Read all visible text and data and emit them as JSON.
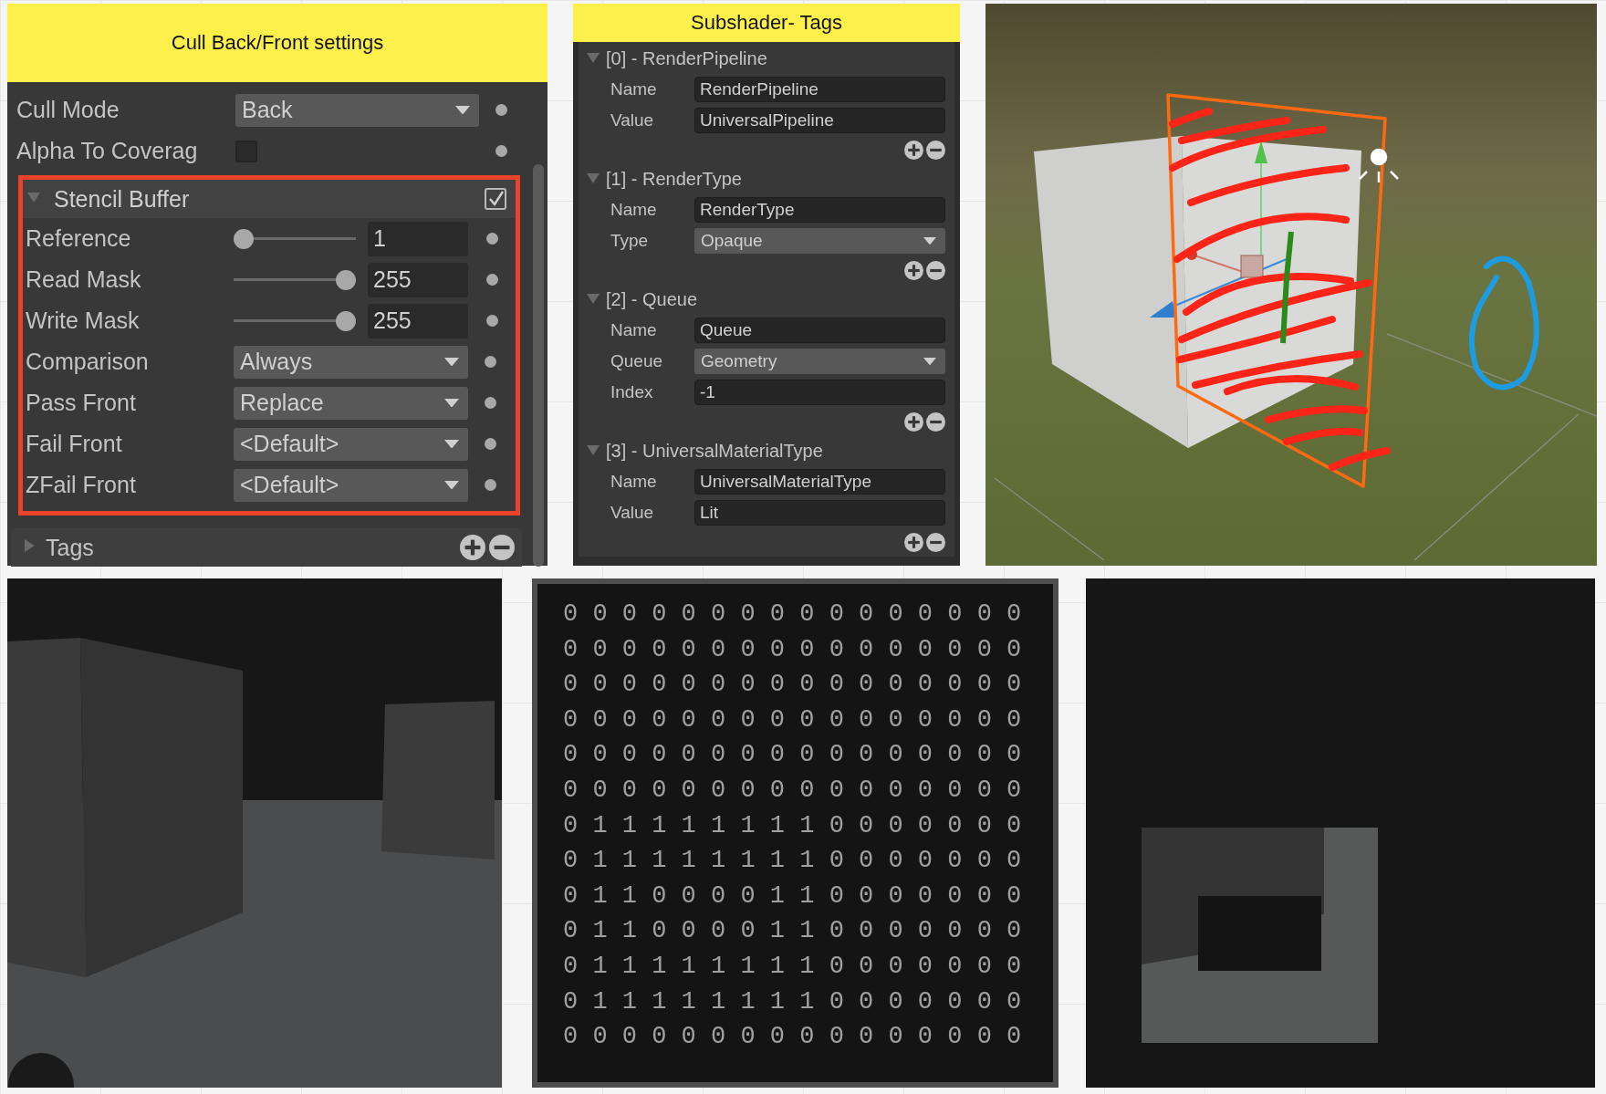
{
  "cull_panel": {
    "title": "Cull Back/Front settings",
    "properties": [
      {
        "kind": "dropdown",
        "label": "Cull Mode",
        "value": "Back"
      },
      {
        "kind": "checkbox",
        "label": "Alpha To Coverag",
        "checked": false
      }
    ],
    "stencil_buffer": {
      "title": "Stencil Buffer",
      "expanded": true,
      "checked": true,
      "properties": [
        {
          "kind": "slider",
          "label": "Reference",
          "value": "1",
          "level": 0
        },
        {
          "kind": "slider",
          "label": "Read Mask",
          "value": "255",
          "level": 1
        },
        {
          "kind": "slider",
          "label": "Write Mask",
          "value": "255",
          "level": 1
        },
        {
          "kind": "dropdown",
          "label": "Comparison",
          "value": "Always"
        },
        {
          "kind": "dropdown",
          "label": "Pass Front",
          "value": "Replace"
        },
        {
          "kind": "dropdown",
          "label": "Fail Front",
          "value": "<Default>"
        },
        {
          "kind": "dropdown",
          "label": "ZFail Front",
          "value": "<Default>"
        }
      ]
    },
    "tags": {
      "title": "Tags",
      "expanded": false
    }
  },
  "tags_panel": {
    "title": "Subshader- Tags",
    "tags": [
      {
        "header": "[0] - RenderPipeline",
        "expanded": true,
        "fields": [
          {
            "kind": "text",
            "label": "Name",
            "value": "RenderPipeline"
          },
          {
            "kind": "text",
            "label": "Value",
            "value": "UniversalPipeline"
          }
        ]
      },
      {
        "header": "[1] - RenderType",
        "expanded": true,
        "fields": [
          {
            "kind": "text",
            "label": "Name",
            "value": "RenderType"
          },
          {
            "kind": "dropdown",
            "label": "Type",
            "value": "Opaque"
          }
        ]
      },
      {
        "header": "[2] - Queue",
        "expanded": true,
        "fields": [
          {
            "kind": "text",
            "label": "Name",
            "value": "Queue"
          },
          {
            "kind": "dropdown",
            "label": "Queue",
            "value": "Geometry"
          },
          {
            "kind": "text",
            "label": "Index",
            "value": "-1"
          }
        ]
      },
      {
        "header": "[3] - UniversalMaterialType",
        "expanded": true,
        "fields": [
          {
            "kind": "text",
            "label": "Name",
            "value": "UniversalMaterialType"
          },
          {
            "kind": "text",
            "label": "Value",
            "value": "Lit"
          }
        ]
      }
    ]
  },
  "stencil_grid": {
    "rows": [
      "0 0 0 0 0 0 0 0 0 0 0 0 0 0 0 0",
      "0 0 0 0 0 0 0 0 0 0 0 0 0 0 0 0",
      "0 0 0 0 0 0 0 0 0 0 0 0 0 0 0 0",
      "0 0 0 0 0 0 0 0 0 0 0 0 0 0 0 0",
      "0 0 0 0 0 0 0 0 0 0 0 0 0 0 0 0",
      "0 0 0 0 0 0 0 0 0 0 0 0 0 0 0 0",
      "0 1 1 1 1 1 1 1 1 0 0 0 0 0 0 0",
      "0 1 1 1 1 1 1 1 1 0 0 0 0 0 0 0",
      "0 1 1 0 0 0 0 1 1 0 0 0 0 0 0 0",
      "0 1 1 0 0 0 0 1 1 0 0 0 0 0 0 0",
      "0 1 1 1 1 1 1 1 1 0 0 0 0 0 0 0",
      "0 1 1 1 1 1 1 1 1 0 0 0 0 0 0 0",
      "0 0 0 0 0 0 0 0 0 0 0 0 0 0 0 0"
    ]
  }
}
